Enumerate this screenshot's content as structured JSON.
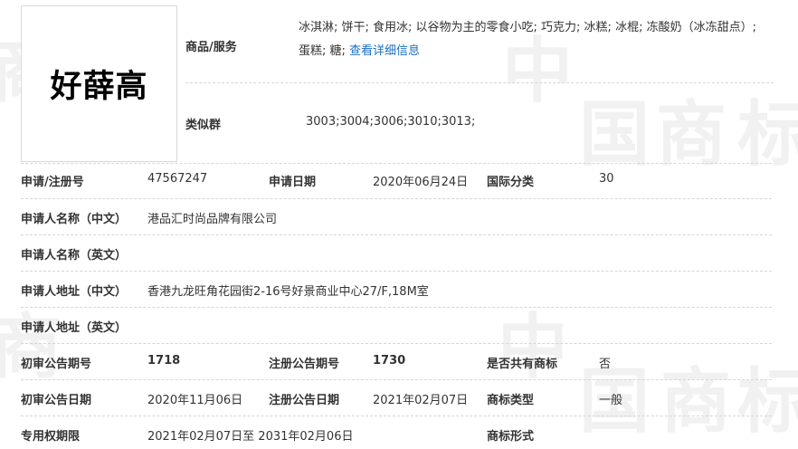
{
  "watermark": {
    "chars": [
      "中",
      "国",
      "商",
      "标"
    ]
  },
  "mark": {
    "name": "好薛高"
  },
  "goods": {
    "label": "商品/服务",
    "items": "冰淇淋; 饼干; 食用冰; 以谷物为主的零食小吃; 巧克力; 冰糕; 冰棍; 冻酸奶（冰冻甜点）; 蛋糕; 糖;",
    "more_link": "查看详细信息"
  },
  "similar_group": {
    "label": "类似群",
    "value": "3003;3004;3006;3010;3013;"
  },
  "rows": {
    "reg_no": {
      "label": "申请/注册号",
      "value": "47567247"
    },
    "apply_date": {
      "label": "申请日期",
      "value": "2020年06月24日"
    },
    "intl_class": {
      "label": "国际分类",
      "value": "30"
    },
    "applicant_cn": {
      "label": "申请人名称（中文）",
      "value": "港品汇时尚品牌有限公司"
    },
    "applicant_en": {
      "label": "申请人名称（英文）",
      "value": ""
    },
    "address_cn": {
      "label": "申请人地址（中文）",
      "value": "香港九龙旺角花园街2-16号好景商业中心27/F,18M室"
    },
    "address_en": {
      "label": "申请人地址（英文）",
      "value": ""
    },
    "prelim_issue": {
      "label": "初审公告期号",
      "value": "1718"
    },
    "reg_issue": {
      "label": "注册公告期号",
      "value": "1730"
    },
    "shared": {
      "label": "是否共有商标",
      "value": "否"
    },
    "prelim_date": {
      "label": "初审公告日期",
      "value": "2020年11月06日"
    },
    "reg_date": {
      "label": "注册公告日期",
      "value": "2021年02月07日"
    },
    "mark_type": {
      "label": "商标类型",
      "value": "一般"
    },
    "exclusive_period": {
      "label": "专用权期限",
      "value": "2021年02月07日至 2031年02月06日"
    },
    "mark_form": {
      "label": "商标形式",
      "value": ""
    }
  }
}
